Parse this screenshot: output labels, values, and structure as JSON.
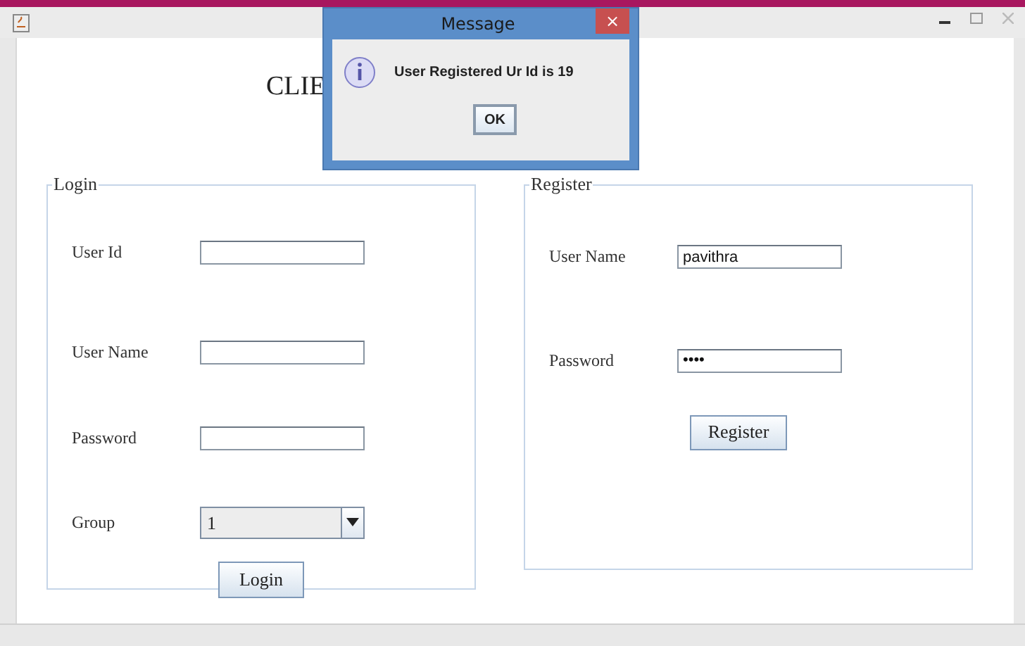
{
  "window": {
    "heading": "CLIE"
  },
  "dialog": {
    "title": "Message",
    "close": "×",
    "message": "User Registered Ur Id is 19",
    "button": "OK"
  },
  "login": {
    "legend": "Login",
    "fields": [
      {
        "label": "User Id",
        "kind": "text"
      },
      {
        "label": "User Name",
        "kind": "text"
      },
      {
        "label": "Password",
        "kind": "text"
      },
      {
        "label": "Group",
        "value": "1",
        "kind": "combo"
      }
    ],
    "button": "Login"
  },
  "register": {
    "legend": "Register",
    "fields": [
      {
        "label": "User Name",
        "value": "pavithra",
        "kind": "text"
      },
      {
        "label": "Password",
        "value": "••••",
        "kind": "text"
      }
    ],
    "button": "Register"
  }
}
